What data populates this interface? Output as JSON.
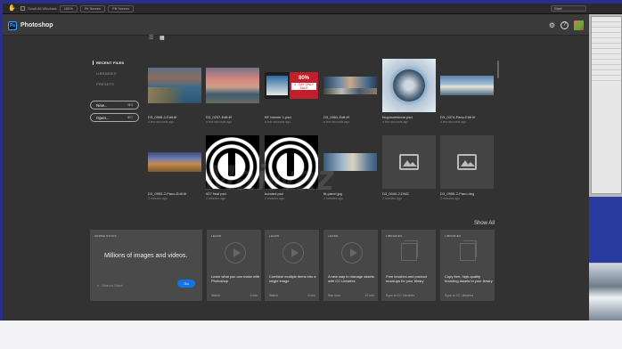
{
  "toolbar": {
    "checkbox_label": "Scroll All Windows",
    "btn1": "100%",
    "btn2": "Fit Screen",
    "btn3": "Fill Screen",
    "select_value": "Start"
  },
  "app": {
    "title": "Photoshop",
    "logo": "Ps"
  },
  "nav": {
    "items": [
      "RECENT FILES",
      "LIBRARIES",
      "PRESETS"
    ],
    "new_label": "New...",
    "new_shortcut": "⌘N",
    "open_label": "Open...",
    "open_shortcut": "⌘O"
  },
  "files": [
    {
      "name": "D3_0958-2-Edit.tif",
      "time": "a few seconds ago"
    },
    {
      "name": "D3_0237-Edit.tif",
      "time": "a few seconds ago"
    },
    {
      "name": "BF banner 1.psd",
      "time": "a few seconds ago"
    },
    {
      "name": "D3_0064-Edit.tif",
      "time": "a few seconds ago"
    },
    {
      "name": "tinyplanetdone.psd",
      "time": "a few seconds ago"
    },
    {
      "name": "D3_0074-Pano-Edit.tif",
      "time": "a few seconds ago"
    },
    {
      "name": "D3_0953-2-Pano-Edit.tif",
      "time": "2 minutes ago"
    },
    {
      "name": "007 final.psd",
      "time": "2 minutes ago"
    },
    {
      "name": "bonded.psd",
      "time": "2 minutes ago"
    },
    {
      "name": "ttt-panel.jpg",
      "time": "2 minutes ago"
    },
    {
      "name": "D3_0040-2.DNG",
      "time": "2 minutes ago"
    },
    {
      "name": "D3_0955-2-Pano.dng",
      "time": "2 minutes ago"
    }
  ],
  "banner": {
    "pct": "80%",
    "sale": "4 - DAY ONLY SALE"
  },
  "show_all": "Show All",
  "stock": {
    "tag": "ADOBE STOCK",
    "headline": "Millions of images and videos.",
    "placeholder": "Search Stock",
    "go": "Go"
  },
  "cards": [
    {
      "tag": "LEARN",
      "desc": "Learn what you can make with Photoshop",
      "action": "Watch",
      "meta": "3 min"
    },
    {
      "tag": "LEARN",
      "desc": "Combine multiple items into a single image",
      "action": "Watch",
      "meta": "5 min"
    },
    {
      "tag": "LEARN",
      "desc": "A new way to manage assets with CC Libraries",
      "action": "See how",
      "meta": "10 min"
    },
    {
      "tag": "LIBRARIES",
      "desc": "Free brushes and product mockups for your library",
      "action": "Sync to CC Libraries",
      "meta": ""
    },
    {
      "tag": "LIBRARIES",
      "desc": "Copy free, high-quality branding assets to your library",
      "action": "Sync to CC Libraries",
      "meta": ""
    }
  ],
  "watermark": "Maiwaz"
}
